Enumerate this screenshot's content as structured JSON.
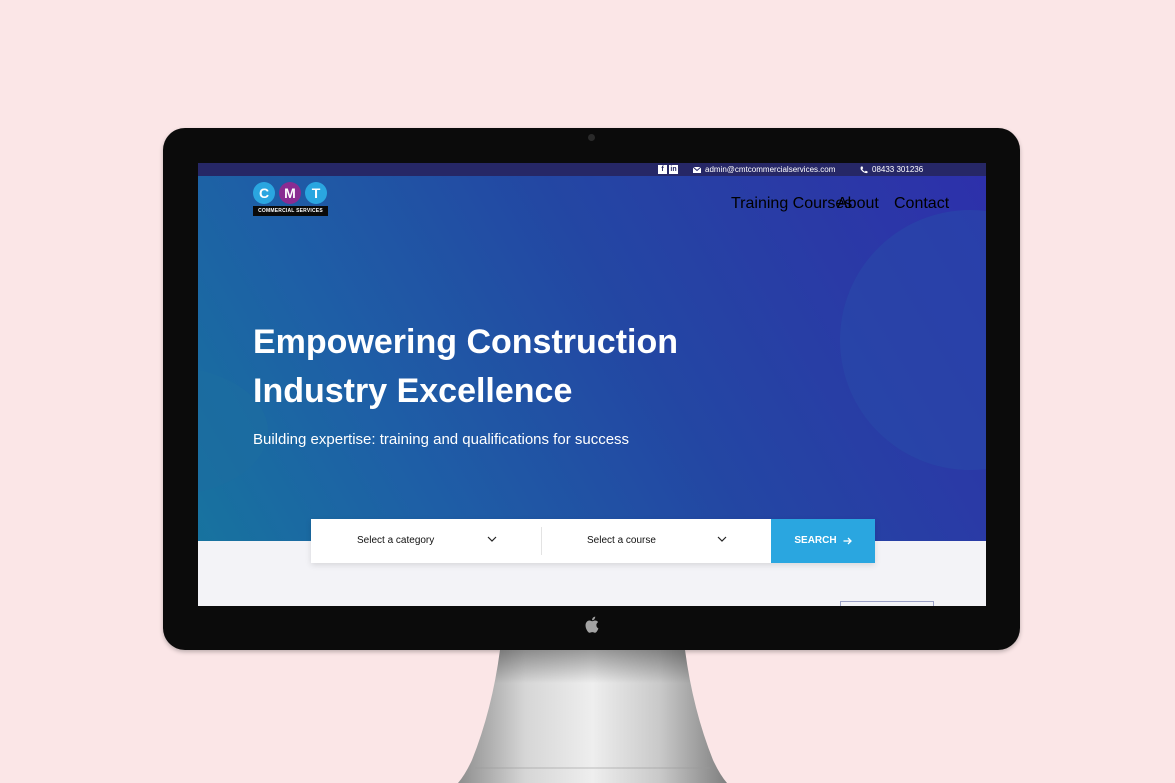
{
  "topbar": {
    "social": [
      "f",
      "in"
    ],
    "email": "admin@cmtcommercialservices.com",
    "phone": "08433 301236"
  },
  "logo": {
    "letters": [
      "C",
      "M",
      "T"
    ],
    "colors": [
      "#2aa6e0",
      "#8a2c92",
      "#2aa6e0"
    ],
    "subtitle": "COMMERCIAL SERVICES"
  },
  "nav": {
    "items": [
      "Training Courses",
      "About",
      "Contact"
    ]
  },
  "hero": {
    "title": "Empowering Construction Industry Excellence",
    "subtitle": "Building expertise: training and qualifications for success"
  },
  "search": {
    "category_placeholder": "Select a category",
    "course_placeholder": "Select a course",
    "button_label": "SEARCH"
  },
  "icons": {
    "facebook": "facebook-icon",
    "linkedin": "linkedin-icon",
    "email": "envelope-icon",
    "phone": "phone-icon",
    "chevron": "chevron-down-icon",
    "arrow": "arrow-right-icon",
    "apple": "apple-logo-icon"
  },
  "colors": {
    "background": "#fbe6e7",
    "topbar": "#262766",
    "accent": "#2aa6e0",
    "hero_start": "#17739f",
    "hero_end": "#2d30ab"
  }
}
